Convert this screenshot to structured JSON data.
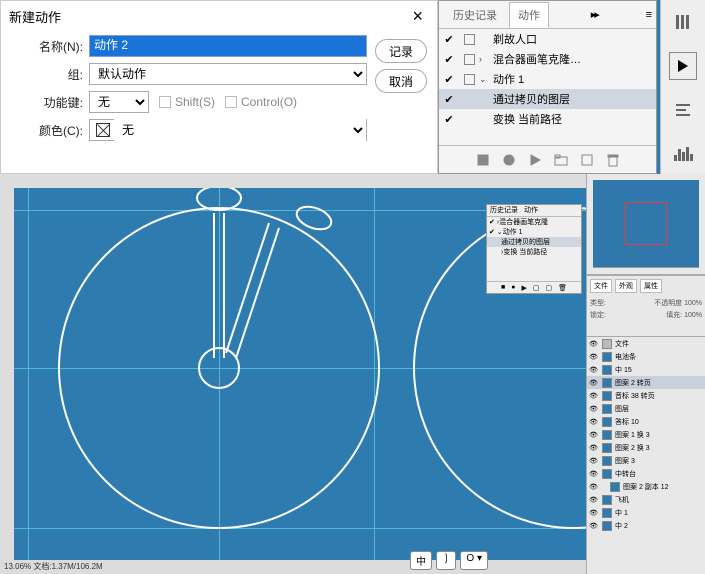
{
  "dialog": {
    "title": "新建动作",
    "name_label": "名称(N):",
    "name_value": "动作 2",
    "group_label": "组:",
    "group_value": "默认动作",
    "funckey_label": "功能键:",
    "funckey_value": "无",
    "shift_label": "Shift(S)",
    "ctrl_label": "Control(O)",
    "color_label": "颜色(C):",
    "color_value": "无",
    "btn_record": "记录",
    "btn_cancel": "取消"
  },
  "actions_panel": {
    "tab_history": "历史记录",
    "tab_actions": "动作",
    "more_glyph": "▸▸",
    "rows": [
      {
        "chk": "✔",
        "label": "剃故人口"
      },
      {
        "chk": "✔",
        "arrow": "›",
        "label": "混合器画笔克隆…"
      },
      {
        "chk": "✔",
        "arrow": "⌄",
        "label": "动作 1"
      },
      {
        "chk": "✔",
        "arrow": "",
        "label": "通过拷贝的图层",
        "indent": true,
        "selected": true
      },
      {
        "chk": "✔",
        "arrow": "›",
        "label": "变换 当前路径",
        "indent": true
      }
    ]
  },
  "mini_panel": {
    "t1": "历史记录",
    "t2": "动作",
    "r1": "混合器画笔克隆",
    "r2": "动作 1",
    "r3": "通过拷贝的图层",
    "r4": "变换 当前路径"
  },
  "zoom": {
    "b1": "中",
    "b2": "❳",
    "b3": "O ▾"
  },
  "props": {
    "tab1": "文件",
    "tab2": "外观",
    "tab3": "属性",
    "kind": "类型:",
    "normal": "不透明度",
    "pct": "100%",
    "lock": "锁定:",
    "fill": "填充:"
  },
  "layers": [
    {
      "name": "文件",
      "group": true
    },
    {
      "name": "电池条"
    },
    {
      "name": "中 15"
    },
    {
      "name": "图案 2 转页",
      "sel": true
    },
    {
      "name": "音标 38 转页"
    },
    {
      "name": "图层"
    },
    {
      "name": "答标 10"
    },
    {
      "name": "图案 1 换 3"
    },
    {
      "name": "图案 2 换 3"
    },
    {
      "name": "图案 3"
    },
    {
      "name": "中转台"
    },
    {
      "name": "图案 2 副本 12",
      "nested": true
    },
    {
      "name": "飞机"
    },
    {
      "name": "中 1"
    },
    {
      "name": "中 2"
    }
  ],
  "status": "13.06%   文档:1.37M/106.2M"
}
